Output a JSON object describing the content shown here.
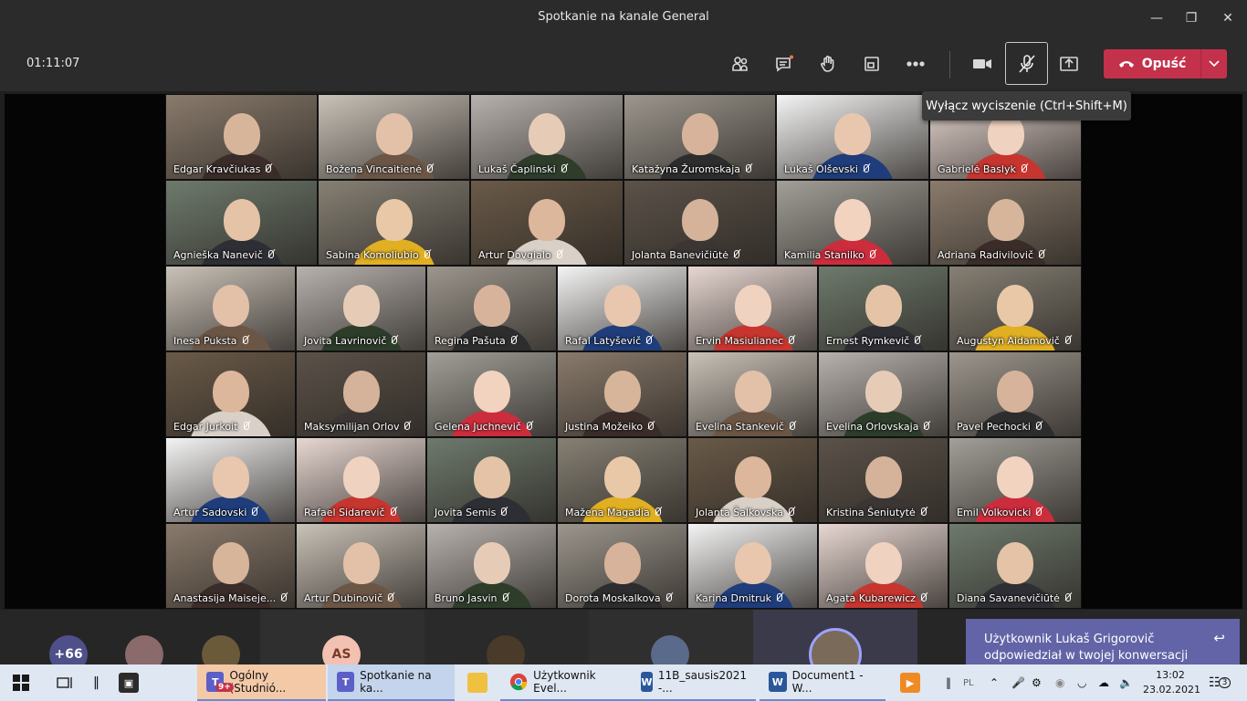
{
  "window": {
    "title": "Spotkanie na kanale General"
  },
  "toolbar": {
    "timer": "01:11:07",
    "leave_label": "Opuść"
  },
  "tooltip": "Wyłącz wyciszenie (Ctrl+Shift+M)",
  "row1": [
    "Edgar Kravčiukas",
    "Božena Vincaitienė",
    "Lukaš Čaplinski",
    "Katažyna Žuromskaja",
    "Lukaš Olševski",
    "Gabrielė Baslyk"
  ],
  "row2": [
    "Agnieška Nanevič",
    "Sabina Komoliubio",
    "Artur Dovgialo",
    "Jolanta Banevičiūtė",
    "Kamilia Stanilko",
    "Adriana Radivilovič"
  ],
  "row3": [
    "Inesa Puksta",
    "Jovita Lavrinovič",
    "Regina Pašuta",
    "Rafal Latyševič",
    "Ervin Masiulianec",
    "Ernest Rymkevič",
    "Augustyn Aidamovič"
  ],
  "row4": [
    "Edgar Jurkoit",
    "Maksymilijan Orlov",
    "Gelena Juchnevič",
    "Justina Možeiko",
    "Evelina Stankevič",
    "Evelina Orlovskaja",
    "Pavel Pechocki"
  ],
  "row5": [
    "Artur Sadovski",
    "Rafael Sidarevič",
    "Jovita Semis",
    "Mažena Magadia",
    "Jolanta Šalkovska",
    "Kristina Šeniutytė",
    "Emil Volkovicki"
  ],
  "row6": [
    "Anastasija Maiseje...",
    "Artur Dubinovič",
    "Bruno Jasvin",
    "Dorota Moskalkova",
    "Karina Dmitruk",
    "Agata Kubarewicz",
    "Diana Savanevičiūtė"
  ],
  "bottom_bar": {
    "overflow_count": "+66",
    "initials": "AS"
  },
  "notification": {
    "text": "Użytkownik Lukaš Grigorovič odpowiedział w twojej konwersacji"
  },
  "taskbar": {
    "apps": [
      {
        "label": "Ogólny (Studnió...",
        "badge": "9+"
      },
      {
        "label": "Spotkanie na ka..."
      },
      {
        "label": "Użytkownik Evel..."
      },
      {
        "label": "11B_sausis2021 -..."
      },
      {
        "label": "Document1 - W..."
      }
    ],
    "lang": "PL",
    "time": "13:02",
    "date": "23.02.2021",
    "notif_count": "3"
  },
  "colors": {
    "leave_red": "#c4314b",
    "teams_purple": "#6264a7",
    "taskbar_bg": "#dfe7f2"
  }
}
